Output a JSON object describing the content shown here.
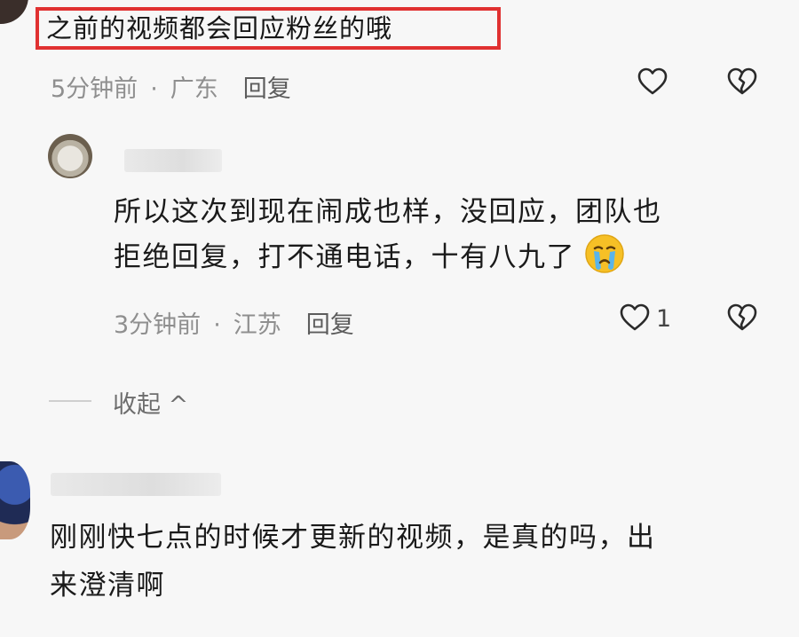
{
  "comment1": {
    "text": "之前的视频都会回应粉丝的哦",
    "time": "5分钟前",
    "location": "广东",
    "reply_label": "回复"
  },
  "reply1": {
    "line1": "所以这次到现在闹成也样，没回应，团队也",
    "line2": "拒绝回复，打不通电话，十有八九了",
    "emoji": "crying-face",
    "time": "3分钟前",
    "location": "江苏",
    "reply_label": "回复",
    "likes": "1"
  },
  "collapse": {
    "label": "收起 ^"
  },
  "comment2": {
    "line1": "刚刚快七点的时候才更新的视频，是真的吗，出",
    "line2": "来澄清啊"
  },
  "separator": "·",
  "colors": {
    "highlight": "#e03131",
    "meta": "#8f8f8f",
    "emoji": "#f6c026"
  }
}
